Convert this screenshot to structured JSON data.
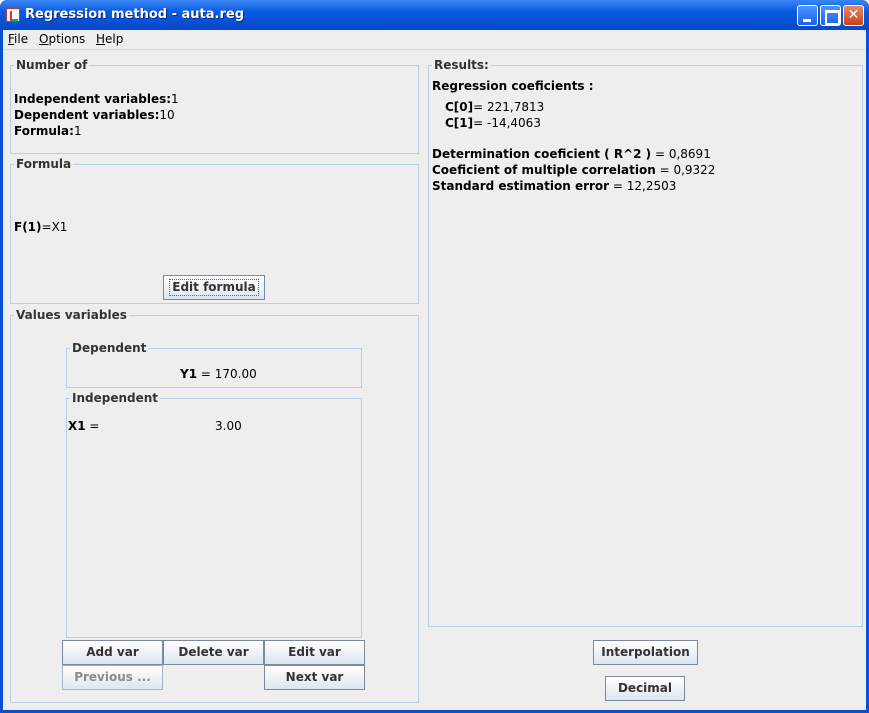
{
  "window": {
    "title": "Regression method - auta.reg"
  },
  "menu": [
    {
      "label": "File",
      "mnemonic": "F",
      "rest": "ile"
    },
    {
      "label": "Options",
      "mnemonic": "O",
      "rest": "ptions"
    },
    {
      "label": "Help",
      "mnemonic": "H",
      "rest": "elp"
    }
  ],
  "number_of": {
    "legend": "Number of",
    "independent_label": "Independent variables:",
    "independent_value": "1",
    "dependent_label": "Dependent variables:",
    "dependent_value": "10",
    "formula_label": "Formula:",
    "formula_value": "1"
  },
  "formula": {
    "legend": "Formula",
    "name": "F(1)",
    "expression": "=X1",
    "edit_button": "Edit formula"
  },
  "values": {
    "legend": "Values variables",
    "dependent": {
      "legend": "Dependent",
      "name": "Y1",
      "value": " = 170.00"
    },
    "independent": {
      "legend": "Independent",
      "name": "X1",
      "eq": " =",
      "value": "3.00"
    },
    "buttons": {
      "add": "Add var",
      "delete": "Delete var",
      "edit": "Edit var",
      "previous": "Previous ...",
      "next": "Next var"
    }
  },
  "results": {
    "legend": "Results:",
    "coef_heading": "Regression coeficients :",
    "c0_label": "C[0]",
    "c0_value": "= 221,7813",
    "c1_label": "C[1]",
    "c1_value": "= -14,4063",
    "determination_label": "Determination coeficient  ( R^2 )",
    "determination_value": " = 0,8691",
    "correlation_label": "Coeficient of multiple correlation",
    "correlation_value": " = 0,9322",
    "error_label": "Standard estimation error",
    "error_value": " = 12,2503"
  },
  "buttons": {
    "interpolation": "Interpolation",
    "decimal": "Decimal"
  }
}
